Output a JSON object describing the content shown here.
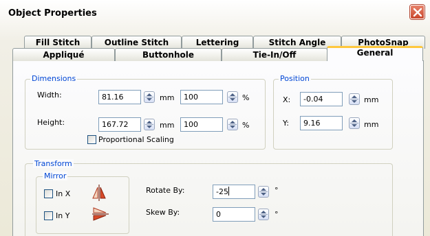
{
  "window": {
    "title": "Object Properties",
    "close_icon": "close-icon"
  },
  "tabs_back": [
    "Fill Stitch",
    "Outline Stitch",
    "Lettering",
    "Stitch Angle",
    "PhotoSnap"
  ],
  "tabs_front": [
    "Appliqué",
    "Buttonhole",
    "Tie-In/Off",
    "General"
  ],
  "active_tab": "General",
  "dimensions": {
    "legend": "Dimensions",
    "width_label": "Width:",
    "width_value": "81.16",
    "width_unit": "mm",
    "width_pct": "100",
    "width_pct_unit": "%",
    "height_label": "Height:",
    "height_value": "167.72",
    "height_unit": "mm",
    "height_pct": "100",
    "height_pct_unit": "%",
    "proportional_label": "Proportional Scaling"
  },
  "position": {
    "legend": "Position",
    "x_label": "X:",
    "x_value": "-0.04",
    "x_unit": "mm",
    "y_label": "Y:",
    "y_value": "9.16",
    "y_unit": "mm"
  },
  "transform": {
    "legend": "Transform",
    "mirror_legend": "Mirror",
    "in_x_label": "In X",
    "in_y_label": "In Y",
    "rotate_label": "Rotate By:",
    "rotate_value": "-25",
    "rotate_unit": "°",
    "skew_label": "Skew By:",
    "skew_value": "0",
    "skew_unit": "°"
  }
}
